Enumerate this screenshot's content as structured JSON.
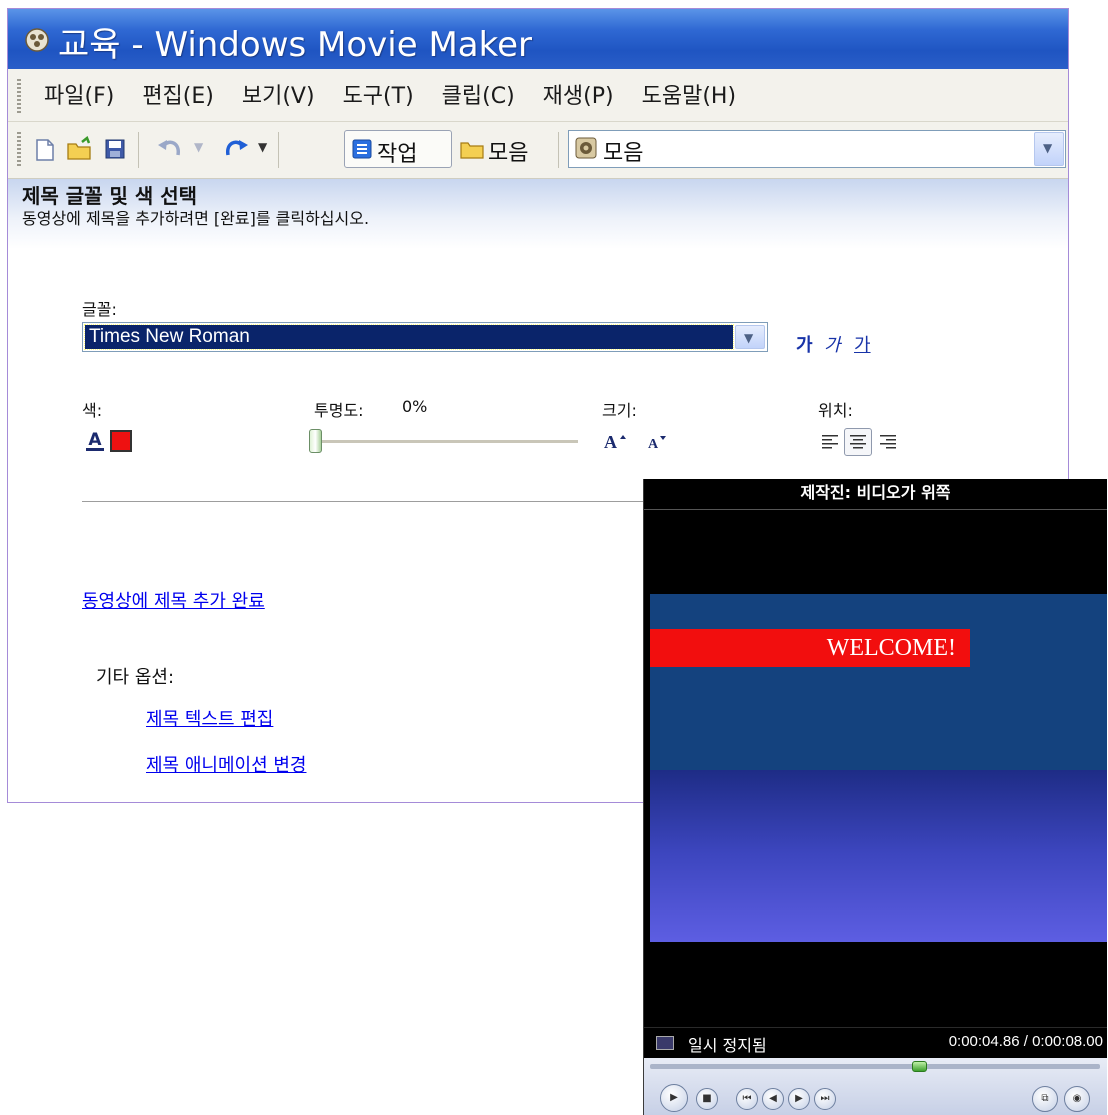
{
  "window": {
    "title": "교육 - Windows Movie Maker"
  },
  "menu": [
    "파일(F)",
    "편집(E)",
    "보기(V)",
    "도구(T)",
    "클립(C)",
    "재생(P)",
    "도움말(H)"
  ],
  "toolbar": {
    "tasks_label": "작업",
    "collections_label": "모음",
    "collection_combo_value": "모음"
  },
  "panel": {
    "title": "제목 글꼴 및 색 선택",
    "subtitle": "동영상에 제목을 추가하려면 [완료]를 클릭하십시오.",
    "font_label": "글꼴:",
    "font_value": "Times New Roman",
    "style_bold": "가",
    "style_italic": "가",
    "style_underline": "가",
    "color_label": "색:",
    "color_value": "#ee1111",
    "transparency_label": "투명도:",
    "transparency_value": "0%",
    "transparency_fraction": 0,
    "size_label": "크기:",
    "position_label": "위치:",
    "done_link": "동영상에 제목 추가 완료",
    "other_options_label": "기타 옵션:",
    "edit_text_link": "제목 텍스트 편집",
    "change_animation_link": "제목 애니메이션 변경"
  },
  "monitor": {
    "title": "제작진: 비디오가 위쪽",
    "banner_text": "WELCOME!",
    "status": "일시 정지됨",
    "time": "0:00:04.86 / 0:00:08.00",
    "seek_fraction": 0.6
  }
}
